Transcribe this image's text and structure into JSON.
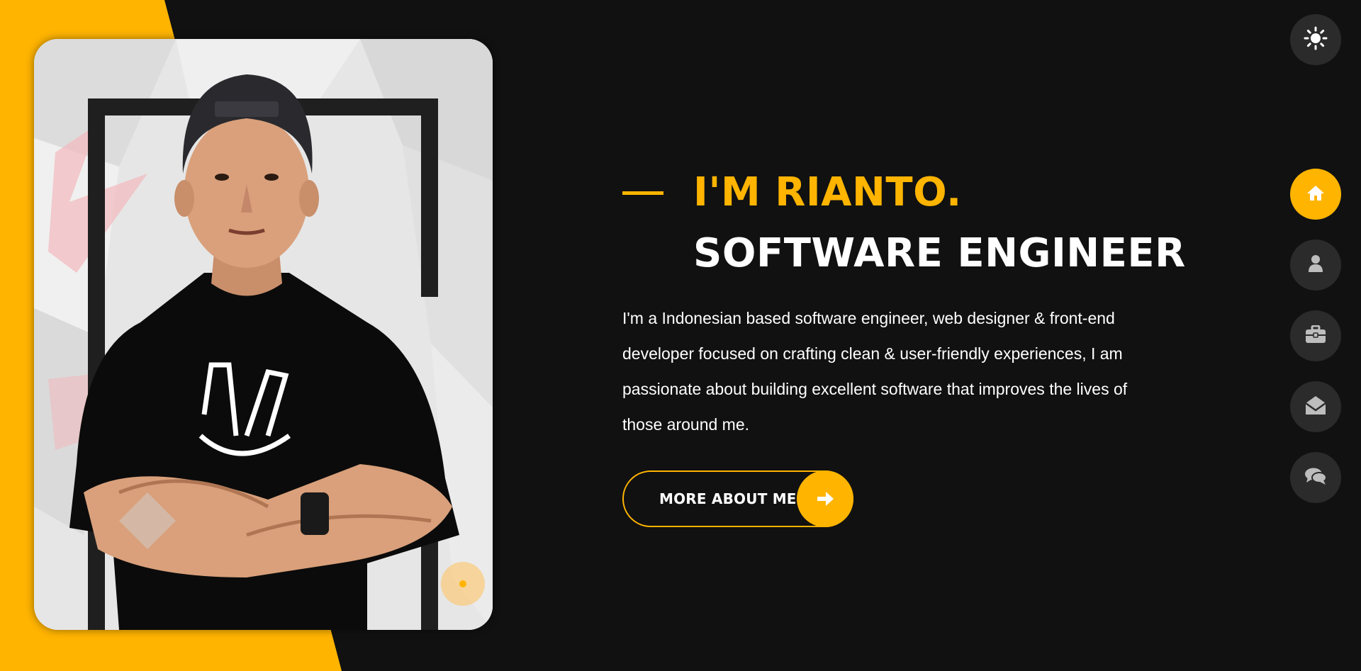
{
  "hero": {
    "name_line": "I'M RIANTO.",
    "role_line": "SOFTWARE ENGINEER",
    "bio": "I'm a Indonesian based software engineer, web designer & front-end developer focused on crafting clean & user-friendly experiences, I am passionate about building excellent software that improves the lives of those around me.",
    "cta_label": "MORE ABOUT ME",
    "cta_icon": "arrow-right-icon"
  },
  "theme_toggle": {
    "icon": "sun-icon"
  },
  "nav": {
    "items": [
      {
        "id": "home",
        "icon": "home-icon",
        "active": true
      },
      {
        "id": "about",
        "icon": "user-icon",
        "active": false
      },
      {
        "id": "portfolio",
        "icon": "briefcase-icon",
        "active": false
      },
      {
        "id": "contact",
        "icon": "envelope-open-icon",
        "active": false
      },
      {
        "id": "blog",
        "icon": "comments-icon",
        "active": false
      }
    ]
  },
  "colors": {
    "accent": "#ffb400",
    "background": "#111111",
    "nav_bg": "#2b2b2b",
    "text": "#ffffff"
  }
}
